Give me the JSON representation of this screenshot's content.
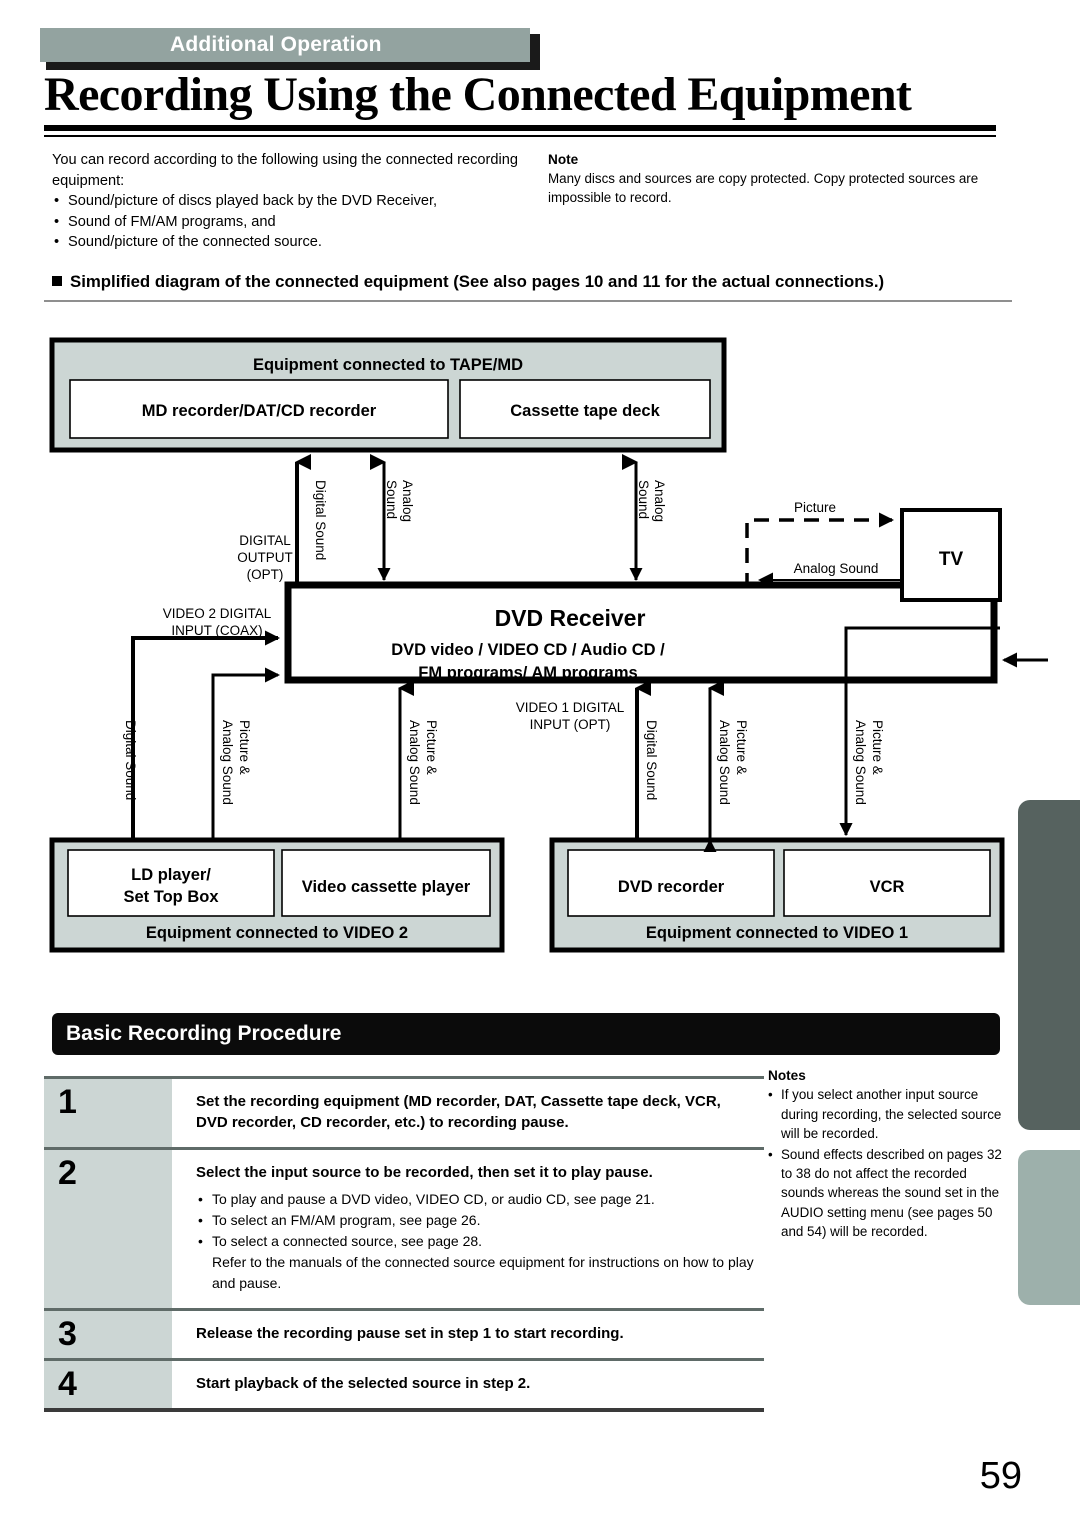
{
  "header": {
    "section_tag": "Additional Operation",
    "title": "Recording Using the Connected Equipment"
  },
  "intro": {
    "lead": "You can record according to the following using the connected recording equipment:",
    "bullets": [
      "Sound/picture of discs played back by the DVD Receiver,",
      "Sound of FM/AM programs, and",
      "Sound/picture of the connected source."
    ]
  },
  "note_top": {
    "heading": "Note",
    "text": "Many discs and sources are copy protected. Copy protected sources are impossible to record."
  },
  "diagram_heading": "Simplified diagram of the connected equipment (See also pages 10 and 11 for the actual connections.)",
  "diagram": {
    "tape_md_group": {
      "label": "Equipment connected to TAPE/MD",
      "boxes": [
        "MD recorder/DAT/CD recorder",
        "Cassette tape deck"
      ]
    },
    "receiver": {
      "title": "DVD Receiver",
      "line1": "DVD video / VIDEO CD / Audio CD /",
      "line2": "FM programs/ AM programs"
    },
    "tv": {
      "label": "TV"
    },
    "video2_group": {
      "label": "Equipment connected to VIDEO 2",
      "boxes": [
        "LD player/\nSet Top Box",
        "Video cassette player"
      ]
    },
    "video1_group": {
      "label": "Equipment connected to VIDEO 1",
      "boxes": [
        "DVD recorder",
        "VCR"
      ]
    },
    "port_labels": {
      "digital_output_opt": "DIGITAL\nOUTPUT\n(OPT)",
      "video2_digital_input_coax": "VIDEO 2 DIGITAL\nINPUT (COAX)",
      "video1_digital_input_opt": "VIDEO 1 DIGITAL\nINPUT (OPT)"
    },
    "signal_labels": {
      "digital_sound": "Digital Sound",
      "analog_sound": "Analog Sound",
      "analog_sound_2line": "Analog\nSound",
      "picture": "Picture",
      "picture_analog_sound": "Picture &\nAnalog Sound"
    }
  },
  "procedure": {
    "bar_title": "Basic Recording Procedure",
    "steps": [
      {
        "num": "1",
        "text": "Set the recording equipment (MD recorder, DAT, Cassette tape deck, VCR, DVD recorder, CD recorder, etc.) to recording pause.",
        "bullets": [],
        "continuation": ""
      },
      {
        "num": "2",
        "text": "Select the input source to be recorded, then set it to play pause.",
        "bullets": [
          "To play and pause a DVD video, VIDEO CD, or audio CD, see page 21.",
          "To select an FM/AM program, see page 26.",
          "To select a connected source, see page 28."
        ],
        "continuation": "Refer to the manuals of the connected source equipment for instructions on how to play and pause."
      },
      {
        "num": "3",
        "text": "Release the recording pause set in step 1 to start recording.",
        "bullets": [],
        "continuation": ""
      },
      {
        "num": "4",
        "text": "Start playback of the selected source in step 2.",
        "bullets": [],
        "continuation": ""
      }
    ]
  },
  "notes_side": {
    "heading": "Notes",
    "items": [
      "If you select another input source during recording, the selected source will be recorded.",
      "Sound effects described on pages 32 to 38 do not affect the recorded sounds whereas the sound set in the AUDIO setting menu (see pages 50 and 54) will be recorded."
    ]
  },
  "page_number": "59",
  "colors": {
    "section_tag_bg": "#93a3a0",
    "group_box_bg": "#ccd6d4",
    "bar_bg": "#0b0b0b",
    "tab_dark": "#56625f",
    "tab_light": "#9db0ab",
    "rule": "#5f6b68"
  }
}
